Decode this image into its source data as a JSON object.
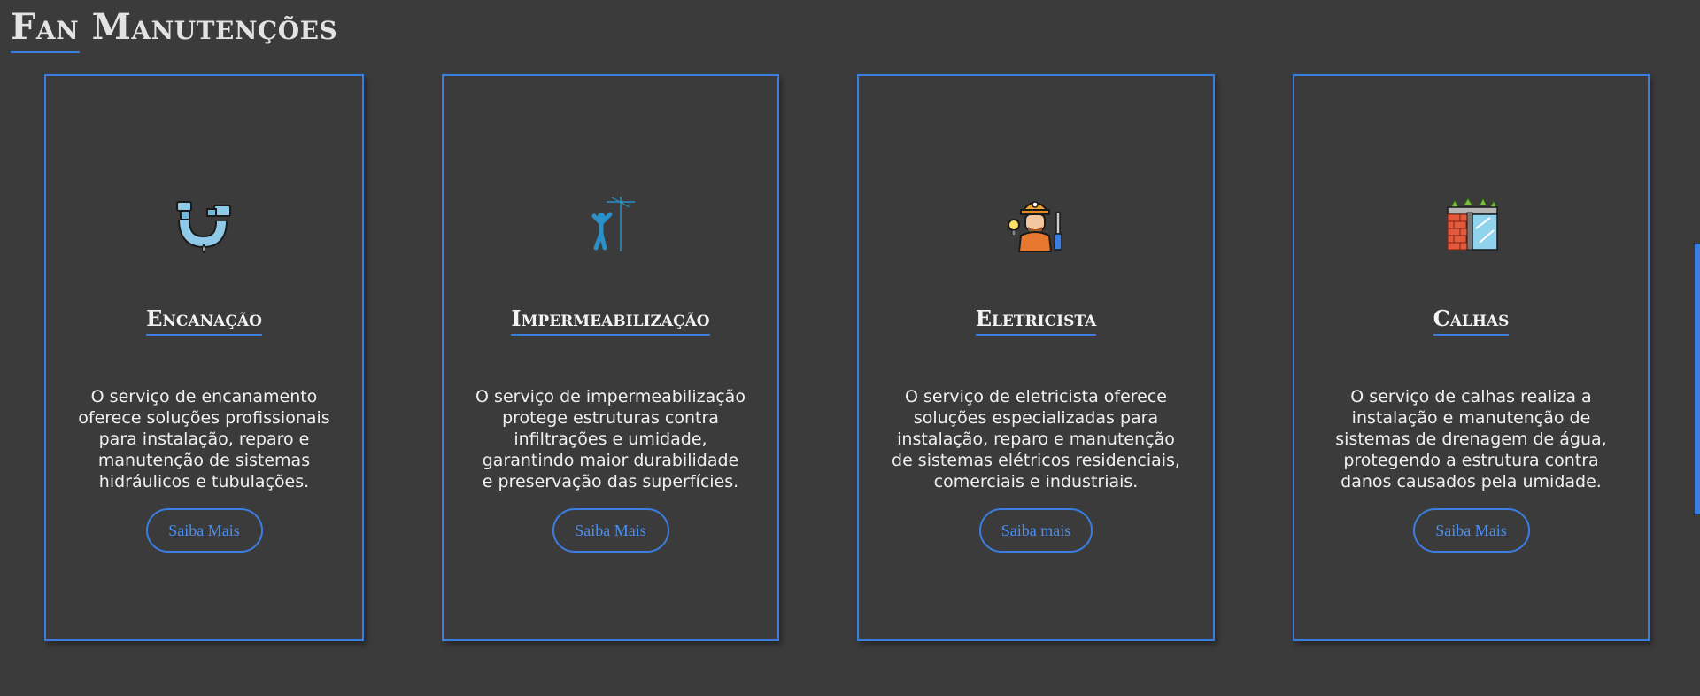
{
  "header": {
    "title": "Fan Manutenções"
  },
  "colors": {
    "background": "#3b3b3b",
    "accent": "#3b7de0",
    "button_text": "#4b8ff0"
  },
  "cards": [
    {
      "icon": "pipe-plumbing-icon",
      "title": "Encanação",
      "text": "O serviço de encanamento oferece soluções profissionais para instalação, reparo e manutenção de sistemas hidráulicos e tubulações.",
      "button": "Saiba Mais"
    },
    {
      "icon": "waterproofing-worker-icon",
      "title": "Impermeabilização",
      "text": "O serviço de impermeabilização protege estruturas contra infiltrações e umidade, garantindo maior durabilidade e preservação das superfícies.",
      "button": "Saiba Mais"
    },
    {
      "icon": "electrician-icon",
      "title": "Eletricista",
      "text": "O serviço de eletricista oferece soluções especializadas para instalação, reparo e manutenção de sistemas elétricos residenciais, comerciais e industriais.",
      "button": "Saiba mais"
    },
    {
      "icon": "roof-gutter-icon",
      "title": "Calhas",
      "text": "O serviço de calhas realiza a instalação e manutenção de sistemas de drenagem de água, protegendo a estrutura contra danos causados pela umidade.",
      "button": "Saiba Mais"
    }
  ]
}
